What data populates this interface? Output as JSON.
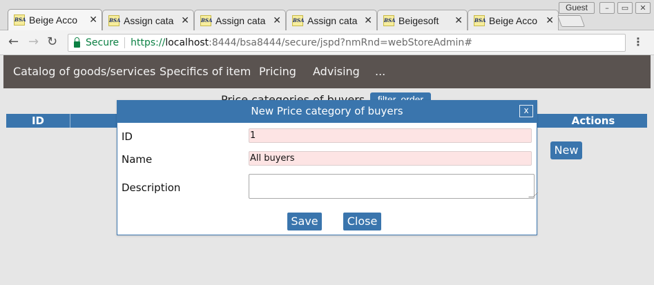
{
  "browser": {
    "tabs": [
      {
        "favicon": "BSA",
        "title": "Beige Acco",
        "active": true
      },
      {
        "favicon": "BSA",
        "title": "Assign cata",
        "active": false
      },
      {
        "favicon": "BSA",
        "title": "Assign cata",
        "active": false
      },
      {
        "favicon": "BSA",
        "title": "Assign cata",
        "active": false
      },
      {
        "favicon": "BSA",
        "title": "Beigesoft",
        "active": false
      },
      {
        "favicon": "BSA",
        "title": "Beige Acco",
        "active": false
      }
    ],
    "profile_label": "Guest",
    "security_label": "Secure",
    "url": {
      "scheme": "https://",
      "host": "localhost",
      "rest": ":8444/bsa8444/secure/jspd?nmRnd=webStoreAdmin#"
    },
    "window_controls": {
      "minimize": "–",
      "maximize": "▭",
      "close": "✕"
    },
    "nav": {
      "back": "←",
      "forward": "→",
      "reload": "↻",
      "menu": "⋮"
    }
  },
  "app_nav": {
    "items": [
      "Catalog of goods/services",
      "Specifics of item",
      "Pricing",
      "Advising",
      "..."
    ]
  },
  "page": {
    "heading": "Price categories of buyers",
    "filter_button": "filter, order",
    "grid_columns": {
      "id": "ID",
      "actions": "Actions"
    },
    "new_button": "New"
  },
  "dialog": {
    "title": "New Price category of buyers",
    "close_label": "x",
    "fields": {
      "id": {
        "label": "ID",
        "value": "1"
      },
      "name": {
        "label": "Name",
        "value": "All buyers"
      },
      "description": {
        "label": "Description",
        "value": ""
      }
    },
    "save_label": "Save",
    "close_button_label": "Close"
  },
  "colors": {
    "accent": "#3a75ad",
    "nav_bg": "#5a5350",
    "required_field_bg": "#fde4e4",
    "secure_green": "#0b8043"
  }
}
